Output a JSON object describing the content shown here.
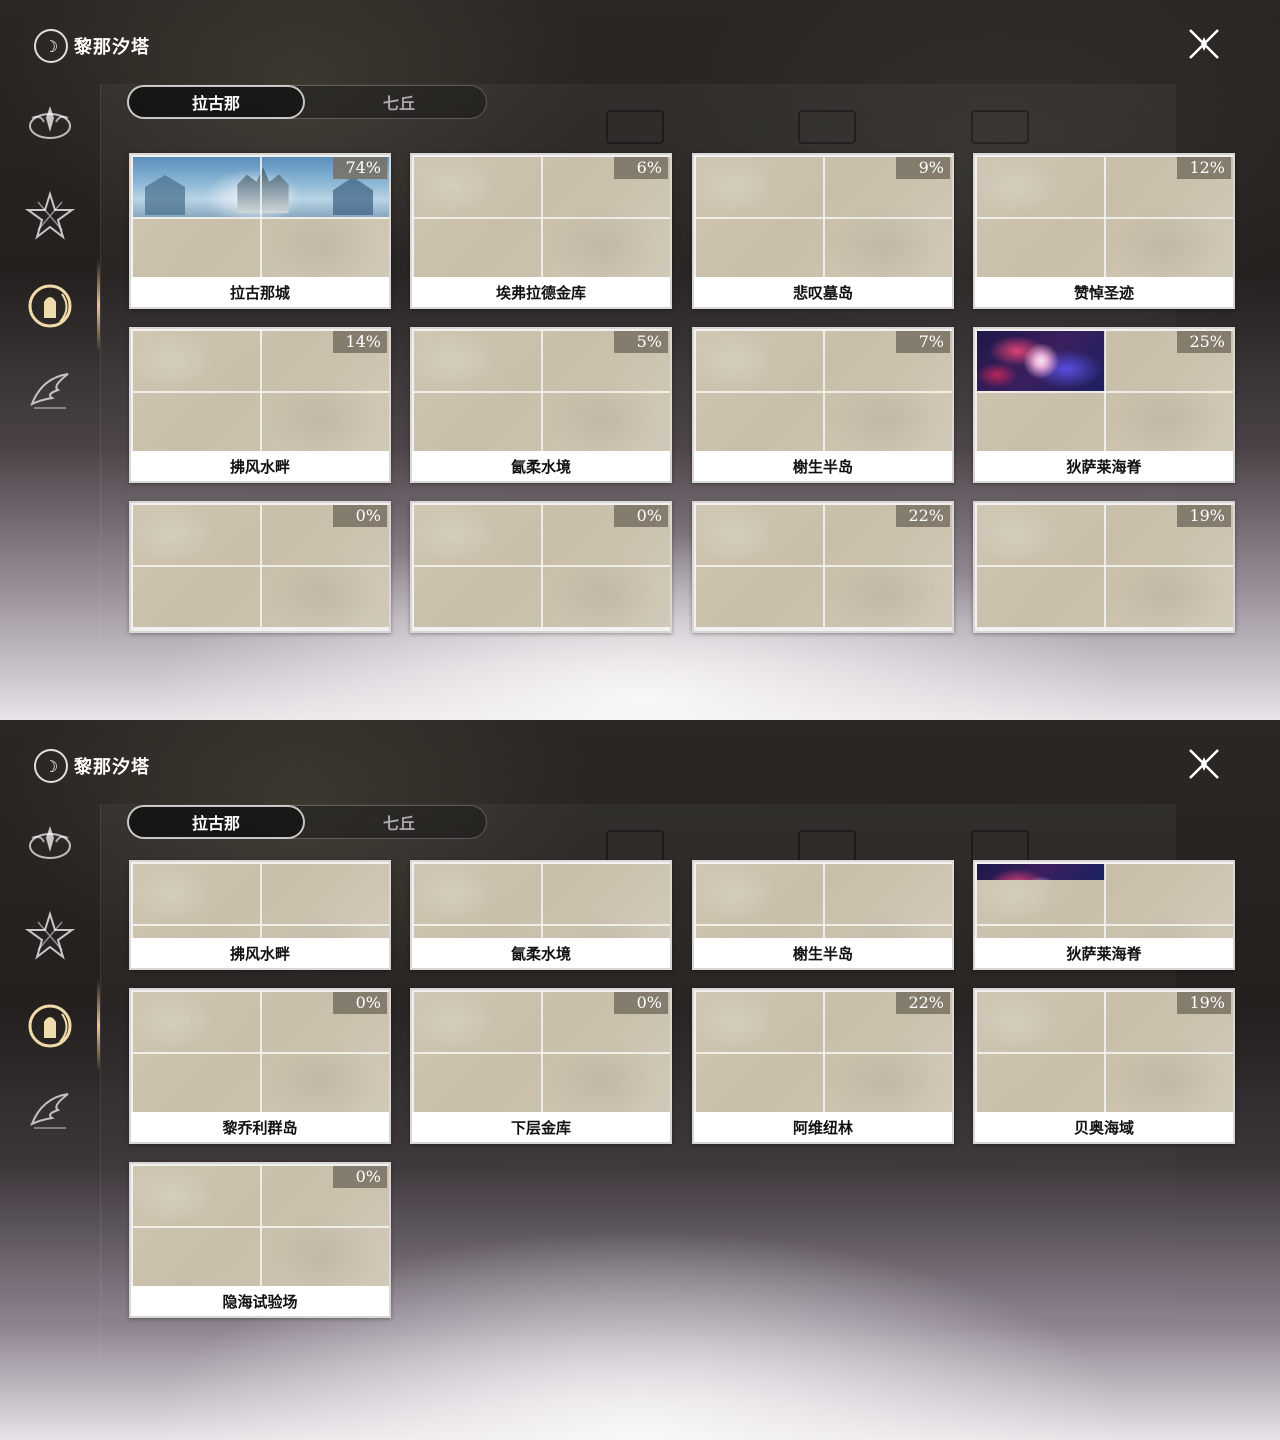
{
  "app": {
    "title": "黎那汐塔"
  },
  "tabs": [
    {
      "label": "拉古那",
      "active": true
    },
    {
      "label": "七丘",
      "active": false
    }
  ],
  "sidebar": {
    "items": [
      {
        "icon": "crest-emblem-icon",
        "active": false
      },
      {
        "icon": "star-emblem-icon",
        "active": false
      },
      {
        "icon": "lady-emblem-icon",
        "active": true
      },
      {
        "icon": "wing-emblem-icon",
        "active": false
      }
    ]
  },
  "regions": [
    {
      "name": "拉古那城",
      "progress": "74%",
      "thumbnail": "castle"
    },
    {
      "name": "埃弗拉德金库",
      "progress": "6%"
    },
    {
      "name": "悲叹墓岛",
      "progress": "9%"
    },
    {
      "name": "赞悼圣迹",
      "progress": "12%"
    },
    {
      "name": "拂风水畔",
      "progress": "14%"
    },
    {
      "name": "氤柔水境",
      "progress": "5%"
    },
    {
      "name": "榭生半岛",
      "progress": "7%"
    },
    {
      "name": "狄萨莱海脊",
      "progress": "25%",
      "thumbnail": "nebula"
    },
    {
      "name": "黎乔利群岛",
      "progress": "0%"
    },
    {
      "name": "下层金库",
      "progress": "0%"
    },
    {
      "name": "阿维纽林",
      "progress": "22%"
    },
    {
      "name": "贝奥海域",
      "progress": "19%"
    },
    {
      "name": "隐海试验场",
      "progress": "0%"
    }
  ],
  "colors": {
    "accent": "#f0dcaa",
    "card_label_bg": "#ffffff",
    "progress_badge": "#786e62"
  }
}
